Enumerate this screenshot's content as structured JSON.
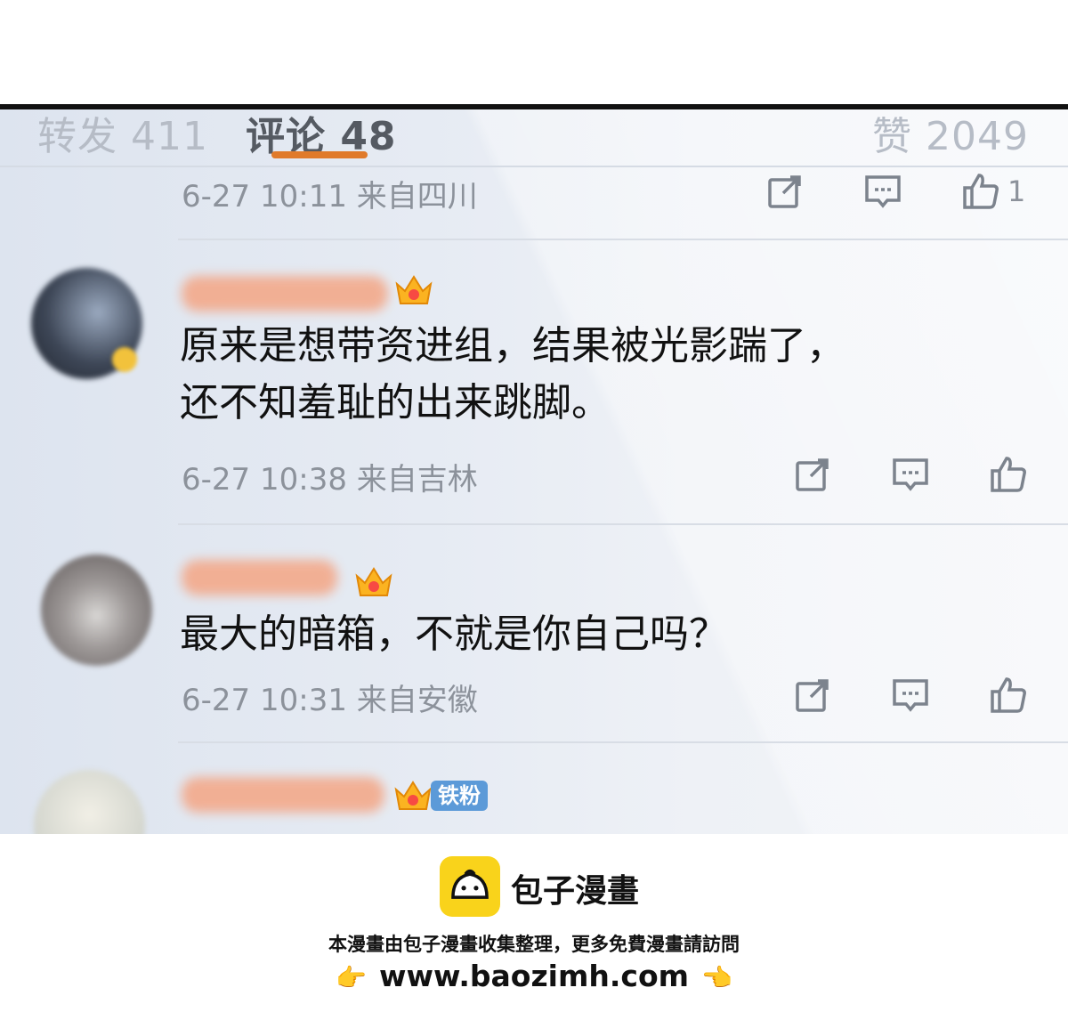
{
  "tabs": {
    "reposts": "转发 411",
    "comments": "评论 48",
    "likes": "赞 2049"
  },
  "comments": [
    {
      "meta": "6-27 10:11 来自四川",
      "like_count": "1"
    },
    {
      "crown_level": "1",
      "text": "原来是想带资进组，结果被光影踹了，\n还不知羞耻的出来跳脚。",
      "meta": "6-27 10:38 来自吉林"
    },
    {
      "crown_level": "5",
      "text": "最大的暗箱，不就是你自己吗？",
      "meta": "6-27 10:31 来自安徽"
    },
    {
      "crown_level": "6",
      "fan_badge": "铁粉"
    }
  ],
  "footer": {
    "brand": "包子漫畫",
    "notice": "本漫畫由包子漫畫收集整理，更多免費漫畫請訪問",
    "url": "www.baozimh.com"
  },
  "colors": {
    "tab_indicator": "#e07a2a",
    "logo_yellow": "#f9d31b",
    "fan_badge": "#5c9ad8"
  },
  "icons": [
    "share-icon",
    "comment-icon",
    "like-icon",
    "crown-icon",
    "pointing-hand-icon"
  ]
}
